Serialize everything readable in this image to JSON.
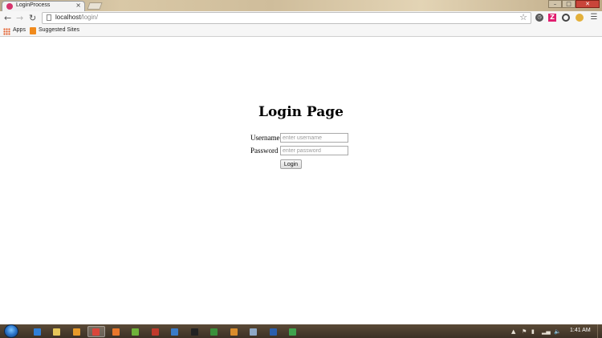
{
  "browser": {
    "tab_title": "LoginProcess",
    "tab_close": "×",
    "url_host": "localhost",
    "url_path": "/login/",
    "bookmarks": {
      "apps_label": "Apps",
      "suggested_label": "Suggested Sites"
    },
    "extensions": [
      "clock-icon",
      "z-icon",
      "circle-icon",
      "cookie-icon"
    ],
    "window_controls": {
      "minimize": "–",
      "maximize": "□",
      "close": "✕"
    }
  },
  "page": {
    "title": "Login Page",
    "username_label": "Username",
    "username_placeholder": "enter username",
    "password_label": "Password",
    "password_placeholder": "enter password",
    "login_button": "Login"
  },
  "taskbar": {
    "apps": [
      {
        "name": "ie",
        "color": "#2f7fd8"
      },
      {
        "name": "explorer",
        "color": "#e6c65a"
      },
      {
        "name": "media-player",
        "color": "#e89a2a"
      },
      {
        "name": "chrome",
        "color": "#d9463b",
        "active": true
      },
      {
        "name": "firefox",
        "color": "#e8762b"
      },
      {
        "name": "app-green",
        "color": "#6fb33a"
      },
      {
        "name": "filezilla",
        "color": "#c0392b"
      },
      {
        "name": "app-blue",
        "color": "#3a7bc8"
      },
      {
        "name": "cmd",
        "color": "#222222"
      },
      {
        "name": "app-terminal",
        "color": "#3a8f3a"
      },
      {
        "name": "app-orange",
        "color": "#d98c2b"
      },
      {
        "name": "app-notepad",
        "color": "#8fa9c8"
      },
      {
        "name": "word",
        "color": "#2b5fad"
      },
      {
        "name": "app-green-arrow",
        "color": "#3fa34d"
      }
    ],
    "clock": "1:41 AM"
  }
}
